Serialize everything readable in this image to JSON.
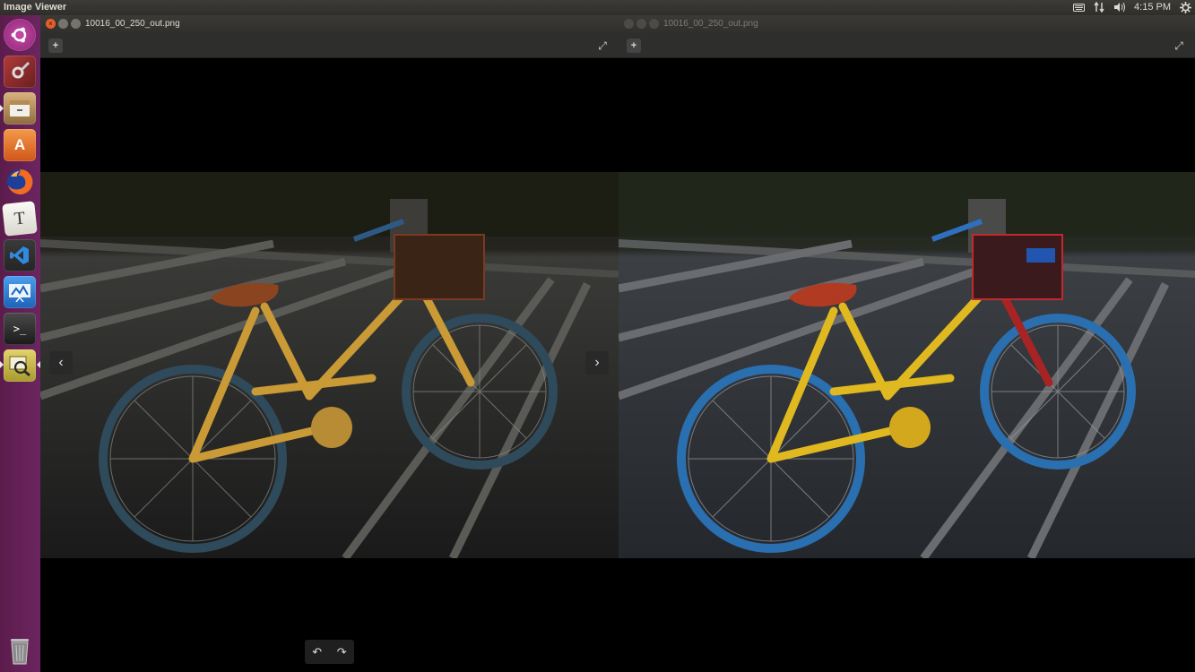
{
  "topbar": {
    "app_title": "Image Viewer",
    "clock": "4:15 PM",
    "icons": [
      "keyboard-icon",
      "network-icon",
      "volume-icon",
      "gear-icon"
    ]
  },
  "launcher": {
    "items": [
      {
        "name": "ubuntu-dash-icon",
        "color": "#a9338e"
      },
      {
        "name": "system-settings-icon",
        "color": "#8a2b2b"
      },
      {
        "name": "files-icon",
        "color": "#b5915e"
      },
      {
        "name": "software-center-icon",
        "color": "#e9772b"
      },
      {
        "name": "firefox-icon",
        "color": "#e55b1a"
      },
      {
        "name": "text-editor-icon",
        "color": "#e8e8e0"
      },
      {
        "name": "vscode-icon",
        "color": "#2b6aa8"
      },
      {
        "name": "presentation-icon",
        "color": "#2f7fd0"
      },
      {
        "name": "terminal-icon",
        "color": "#2b2b2b"
      },
      {
        "name": "image-viewer-icon",
        "color": "#c9b443"
      },
      {
        "name": "trash-icon",
        "color": "#7a7a7a"
      }
    ]
  },
  "windows": [
    {
      "title": "10016_00_250_out.png",
      "active": true
    },
    {
      "title": "10016_00_250_out.png",
      "active": false
    }
  ],
  "labels": {
    "launch_T": "T",
    "launch_term": ">_",
    "launch_A": "A"
  },
  "glyphs": {
    "add": "+",
    "fullscreen": "⤢",
    "prev": "‹",
    "next": "›",
    "rot_left": "↶",
    "rot_right": "↷",
    "close": "×"
  }
}
